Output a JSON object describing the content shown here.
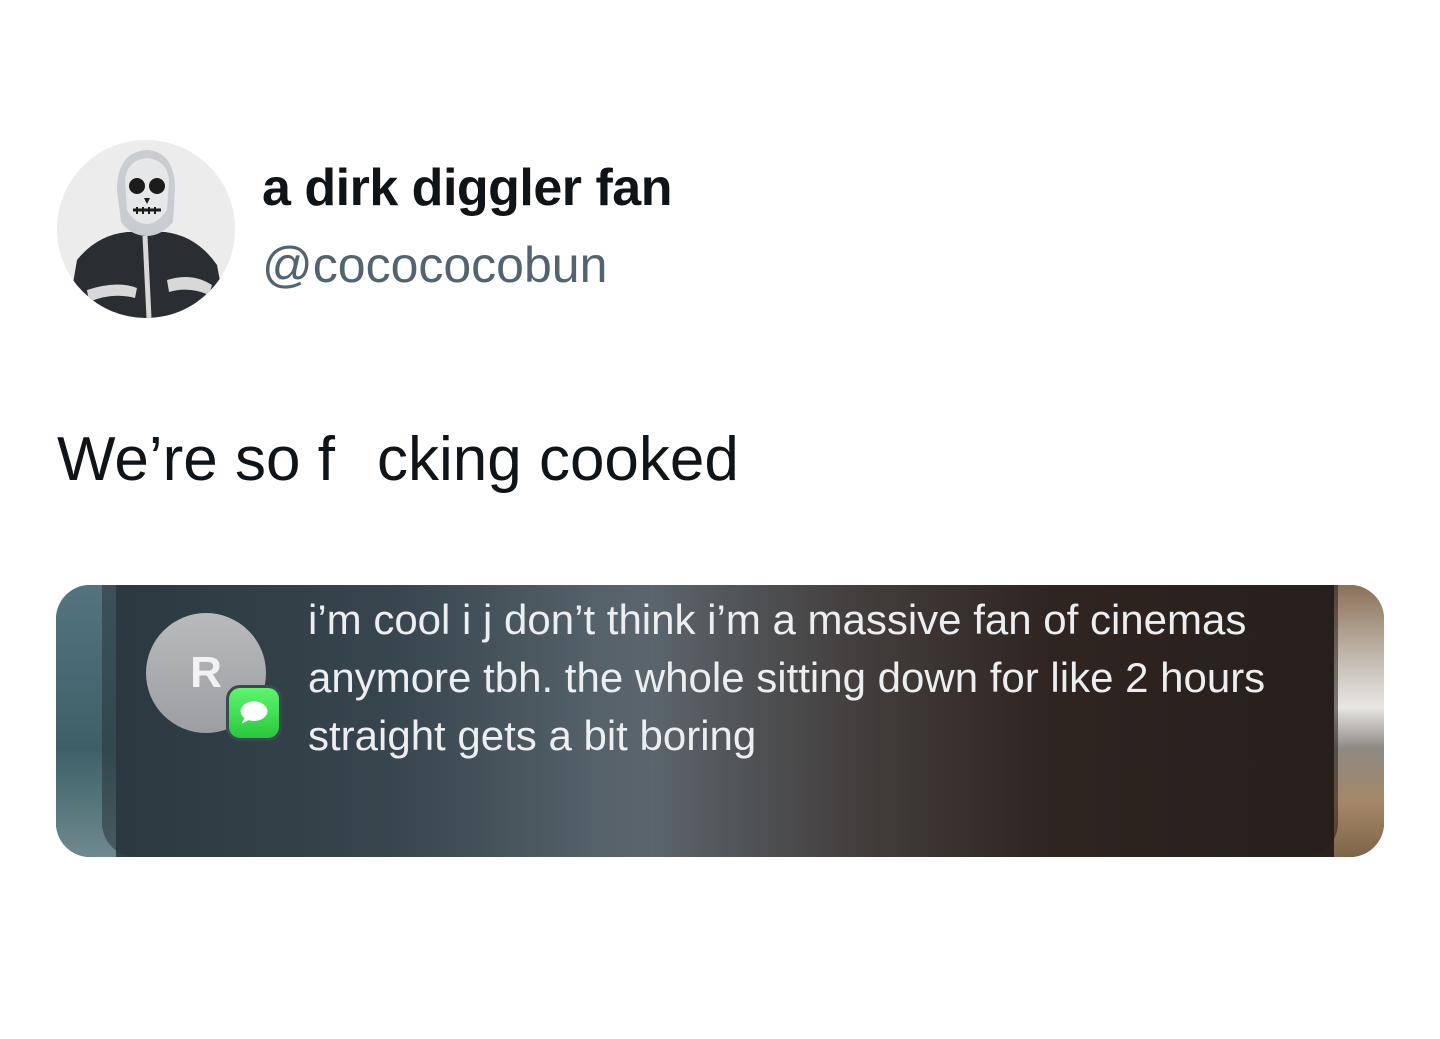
{
  "tweet": {
    "author": {
      "display_name": "a dirk diggler fan",
      "handle": "@cocococobun",
      "avatar_icon": "skull-trooper-avatar"
    },
    "text": "We’re so f   cking cooked"
  },
  "notification": {
    "sender_initial": "R",
    "app_icon": "imessage-icon",
    "message": "i’m cool i j don’t think i’m a massive fan of cinemas anymore tbh. the whole sitting down for like 2 hours straight gets a bit boring"
  },
  "colors": {
    "name_text": "#0f1419",
    "handle_text": "#536471",
    "message_green": "#34c759"
  }
}
